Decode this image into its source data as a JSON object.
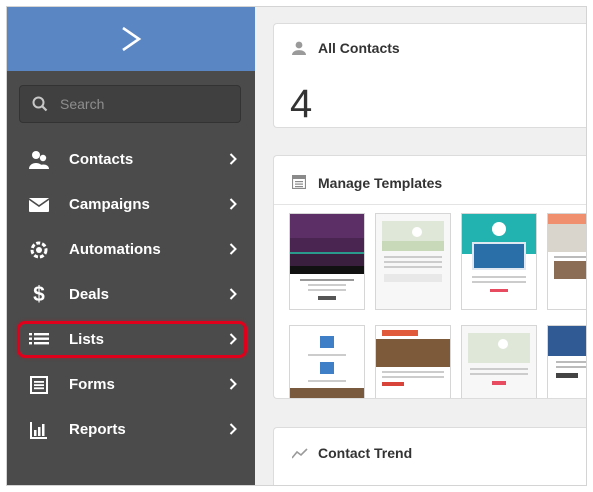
{
  "sidebar": {
    "search_placeholder": "Search",
    "items": [
      {
        "label": "Contacts",
        "icon": "contacts-icon"
      },
      {
        "label": "Campaigns",
        "icon": "envelope-icon"
      },
      {
        "label": "Automations",
        "icon": "gear-icon"
      },
      {
        "label": "Deals",
        "icon": "dollar-icon"
      },
      {
        "label": "Lists",
        "icon": "list-icon",
        "highlighted": true
      },
      {
        "label": "Forms",
        "icon": "form-icon"
      },
      {
        "label": "Reports",
        "icon": "bar-chart-icon"
      }
    ]
  },
  "main": {
    "all_contacts": {
      "title": "All Contacts",
      "count": "4"
    },
    "manage_templates": {
      "title": "Manage Templates"
    },
    "contact_trend": {
      "title": "Contact Trend"
    }
  },
  "colors": {
    "sidebar_bg": "#4b4b4b",
    "brand_bg": "#5b86c4",
    "highlight": "#e0001b"
  }
}
